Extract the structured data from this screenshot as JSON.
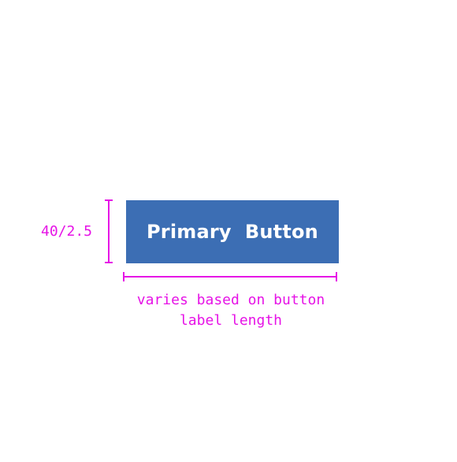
{
  "button": {
    "label": "Primary  Button",
    "color": "#3c6eb4",
    "text_color": "#ffffff"
  },
  "annotations": {
    "color": "#e613e6",
    "height": "40/2.5",
    "width_line1": "varies based on button",
    "width_line2": "label length"
  }
}
